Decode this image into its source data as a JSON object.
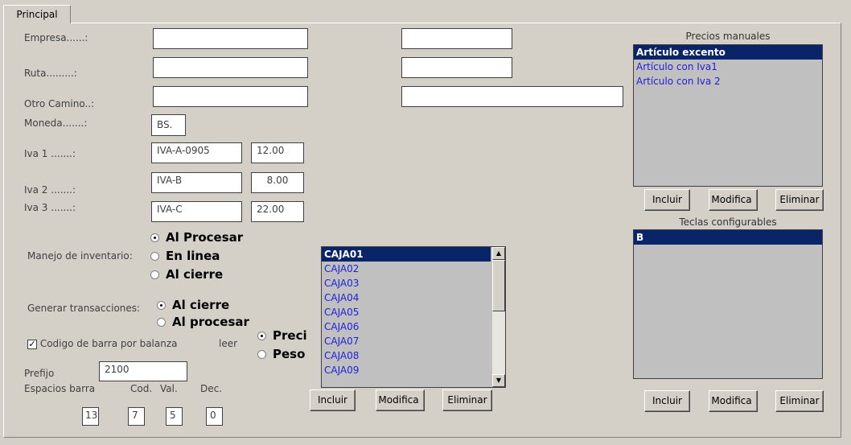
{
  "tab": {
    "label": "Principal"
  },
  "fields": {
    "empresa": {
      "label": "Empresa......:",
      "value": "",
      "value2": ""
    },
    "ruta": {
      "label": "Ruta.........:",
      "value": "",
      "value2": ""
    },
    "otro": {
      "label": "Otro Camino..:",
      "value": "",
      "value2": ""
    },
    "moneda": {
      "label": "Moneda.......:",
      "value": "BS."
    },
    "iva1": {
      "label": "Iva 1 .......:",
      "code": "IVA-A-0905",
      "rate": "12.00"
    },
    "iva2": {
      "label": "Iva 2 .......:",
      "code": "IVA-B",
      "rate": "8.00"
    },
    "iva3": {
      "label": "Iva 3 .......:",
      "code": "IVA-C",
      "rate": "22.00"
    }
  },
  "inventario": {
    "label": "Manejo de inventario:",
    "options": [
      "Al Procesar",
      "En linea",
      "Al cierre"
    ],
    "selected": 0
  },
  "transacciones": {
    "label": "Generar transacciones:",
    "options": [
      "Al cierre",
      "Al procesar"
    ],
    "selected": 0
  },
  "barcode": {
    "checkbox_label": "Codigo de barra por balanza",
    "checked": true,
    "leer_label": "leer",
    "leer_options": [
      "Preci",
      "Peso"
    ],
    "leer_selected": 0
  },
  "prefijo": {
    "label": "Prefijo",
    "value": "2100"
  },
  "espacios": {
    "label": "Espacios barra",
    "cod_label": "Cod.",
    "val_label": "Val.",
    "dec_label": "Dec.",
    "barra": "13",
    "cod": "7",
    "val": "5",
    "dec": "0"
  },
  "cajas": {
    "items": [
      "CAJA01",
      "CAJA02",
      "CAJA03",
      "CAJA04",
      "CAJA05",
      "CAJA06",
      "CAJA07",
      "CAJA08",
      "CAJA09"
    ],
    "selected": 0
  },
  "precios": {
    "title": "Precios manuales",
    "items": [
      "Artículo excento",
      "Artículo con Iva1",
      "Artículo con Iva 2"
    ],
    "selected": 0
  },
  "teclas": {
    "title": "Teclas configurables",
    "items": [
      "B"
    ],
    "selected": 0
  },
  "buttons": {
    "incluir": "Incluir",
    "modifica": "Modifica",
    "eliminar": "Eliminar"
  },
  "colors": {
    "selection": "#0a246a",
    "item_text": "#1f1fd8",
    "background": "#d4d0c8"
  }
}
